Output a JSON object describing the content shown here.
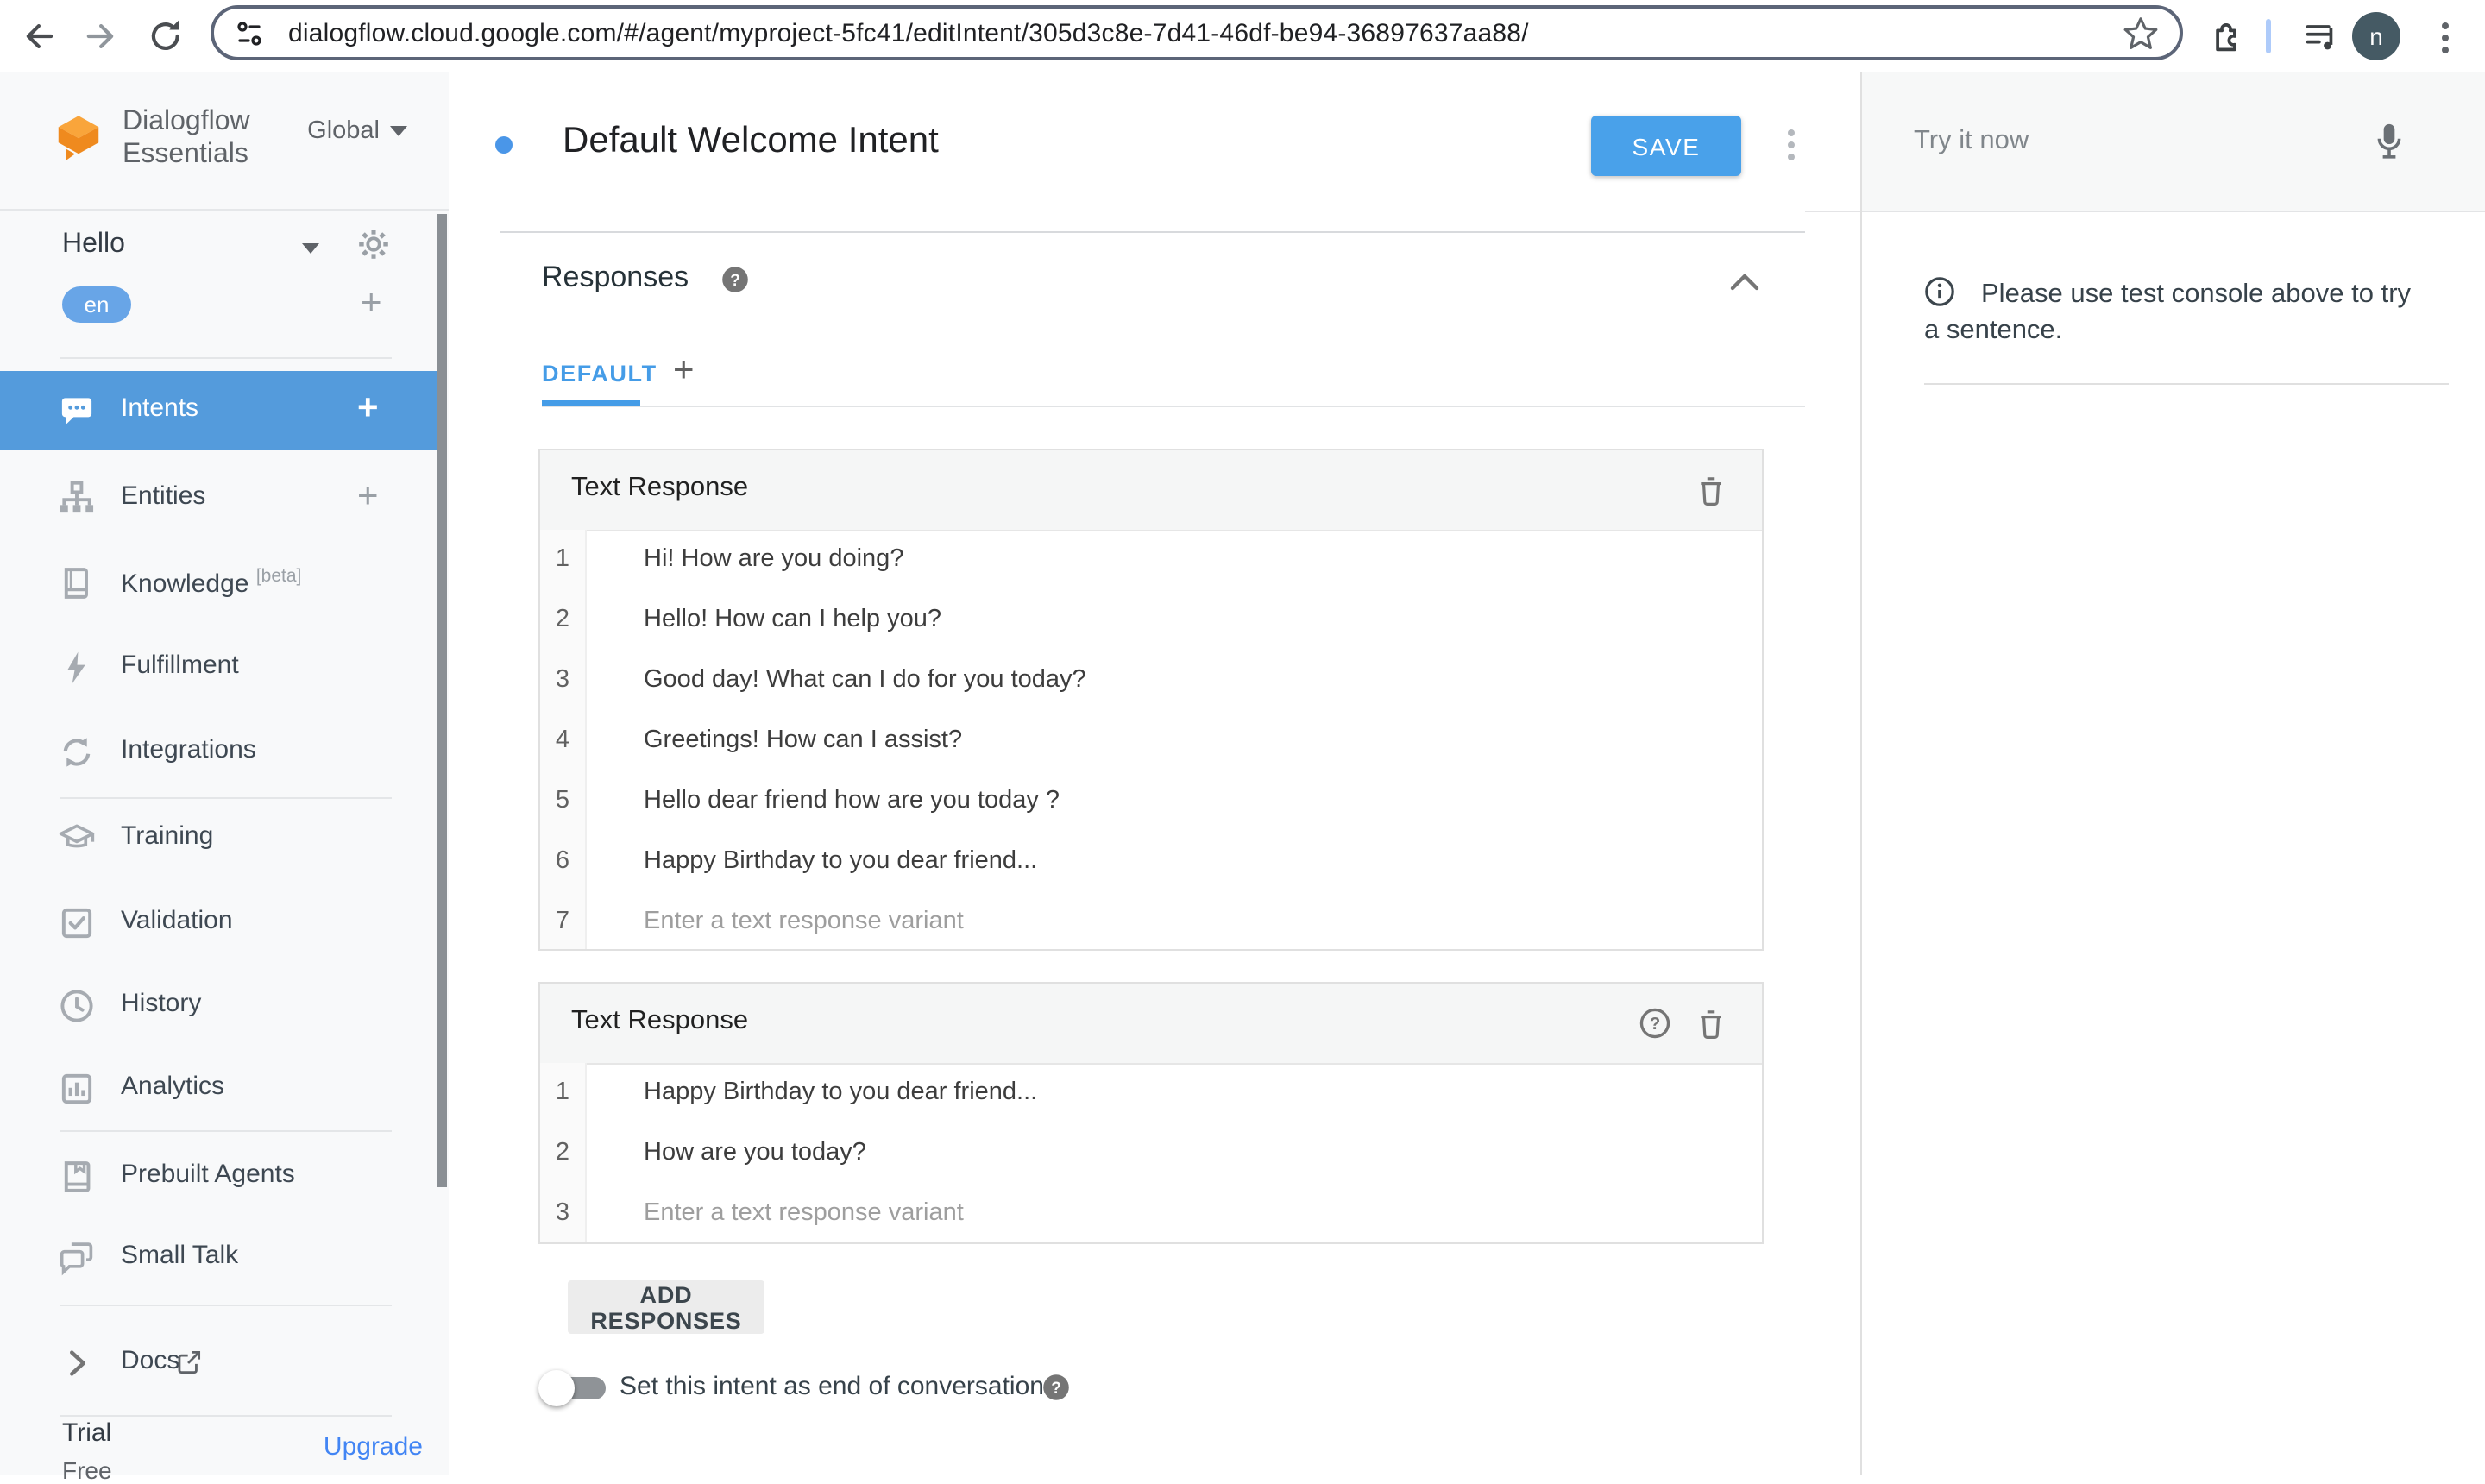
{
  "browser": {
    "url": "dialogflow.cloud.google.com/#/agent/myproject-5fc41/editIntent/305d3c8e-7d41-46df-be94-36897637aa88/",
    "avatar_initial": "n"
  },
  "sidebar": {
    "logo_line1": "Dialogflow",
    "logo_line2": "Essentials",
    "region": "Global",
    "agent_name": "Hello",
    "language": "en",
    "nav": [
      {
        "label": "Intents"
      },
      {
        "label": "Entities"
      },
      {
        "label": "Knowledge",
        "badge": "[beta]"
      },
      {
        "label": "Fulfillment"
      },
      {
        "label": "Integrations"
      },
      {
        "label": "Training"
      },
      {
        "label": "Validation"
      },
      {
        "label": "History"
      },
      {
        "label": "Analytics"
      },
      {
        "label": "Prebuilt Agents"
      },
      {
        "label": "Small Talk"
      }
    ],
    "docs_label": "Docs",
    "plan_tier": "Trial",
    "plan_name": "Free",
    "upgrade_label": "Upgrade"
  },
  "main": {
    "intent_title": "Default Welcome Intent",
    "save_label": "SAVE",
    "responses": {
      "section_title": "Responses",
      "tab_label": "DEFAULT",
      "cards": [
        {
          "title": "Text Response",
          "rows": [
            {
              "num": "1",
              "text": "Hi! How are you doing?"
            },
            {
              "num": "2",
              "text": "Hello! How can I help you?"
            },
            {
              "num": "3",
              "text": "Good day! What can I do for you today?"
            },
            {
              "num": "4",
              "text": "Greetings! How can I assist?"
            },
            {
              "num": "5",
              "text": "Hello dear friend how are you today ?"
            },
            {
              "num": "6",
              "text": "Happy Birthday to you dear friend..."
            },
            {
              "num": "7",
              "placeholder": "Enter a text response variant"
            }
          ]
        },
        {
          "title": "Text Response",
          "rows": [
            {
              "num": "1",
              "text": "Happy Birthday to you dear friend..."
            },
            {
              "num": "2",
              "text": "How are you today?"
            },
            {
              "num": "3",
              "placeholder": "Enter a text response variant"
            }
          ]
        }
      ],
      "add_button": "ADD RESPONSES",
      "end_conversation_label": "Set this intent as end of conversation"
    }
  },
  "right_panel": {
    "placeholder": "Try it now",
    "info_text": "Please use test console above to try a sentence."
  },
  "colors": {
    "accent_blue": "#459ce7",
    "save_blue": "#49a1ea",
    "selected_nav_blue": "#549bdc",
    "language_pill_blue": "#68a5e7",
    "upgrade_blue": "#4285f4"
  }
}
